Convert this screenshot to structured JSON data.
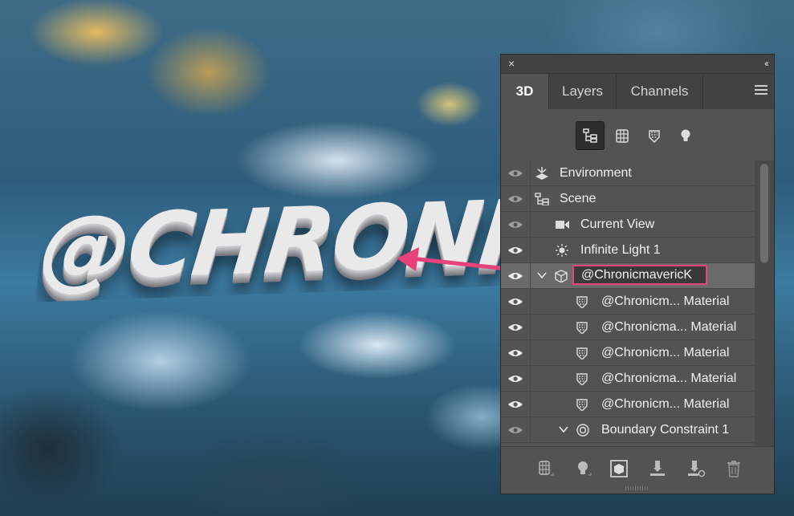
{
  "canvas_text": "@CHRONICMAVERICK",
  "colors": {
    "accent_pink": "#e8427a",
    "panel_bg": "#535353",
    "panel_dark": "#424242",
    "selected_row": "#6a6a6a"
  },
  "panel": {
    "close_glyph": "×",
    "collapse_glyph": "‹‹",
    "tabs": [
      {
        "label": "3D",
        "active": true
      },
      {
        "label": "Layers",
        "active": false
      },
      {
        "label": "Channels",
        "active": false
      }
    ],
    "menu_icon": "hamburger-menu-icon",
    "filters": [
      {
        "icon": "scene-hierarchy-icon",
        "active": true
      },
      {
        "icon": "mesh-icon",
        "active": false
      },
      {
        "icon": "material-icon",
        "active": false
      },
      {
        "icon": "light-bulb-icon",
        "active": false
      }
    ],
    "rows": [
      {
        "label": "Environment",
        "icon": "environment-icon",
        "visible": true,
        "indent": 0
      },
      {
        "label": "Scene",
        "icon": "scene-icon",
        "visible": true,
        "indent": 0
      },
      {
        "label": "Current View",
        "icon": "camera-icon",
        "visible": true,
        "indent": 1
      },
      {
        "label": "Infinite Light 1",
        "icon": "sun-icon",
        "visible": true,
        "indent": 1
      },
      {
        "label": "@ChronicmavericK",
        "icon": "mesh-icon",
        "visible": true,
        "indent": 1,
        "selected": true,
        "expanded": true
      },
      {
        "label": "@Chronicm... Material",
        "icon": "material-icon",
        "visible": true,
        "indent": 2
      },
      {
        "label": "@Chronicma... Material",
        "icon": "material-icon",
        "visible": true,
        "indent": 2
      },
      {
        "label": "@Chronicm... Material",
        "icon": "material-icon",
        "visible": true,
        "indent": 2
      },
      {
        "label": "@Chronicma... Material",
        "icon": "material-icon",
        "visible": true,
        "indent": 2
      },
      {
        "label": "@Chronicm... Material",
        "icon": "material-icon",
        "visible": true,
        "indent": 2
      },
      {
        "label": "Boundary Constraint 1",
        "icon": "constraint-icon",
        "visible": true,
        "indent": 2,
        "expanded": true
      }
    ],
    "bottom_buttons": [
      {
        "icon": "add-mesh-icon"
      },
      {
        "icon": "add-light-icon"
      },
      {
        "icon": "render-icon"
      },
      {
        "icon": "drop-to-plane-icon"
      },
      {
        "icon": "constraint-delete-icon"
      },
      {
        "icon": "trash-icon"
      }
    ]
  }
}
